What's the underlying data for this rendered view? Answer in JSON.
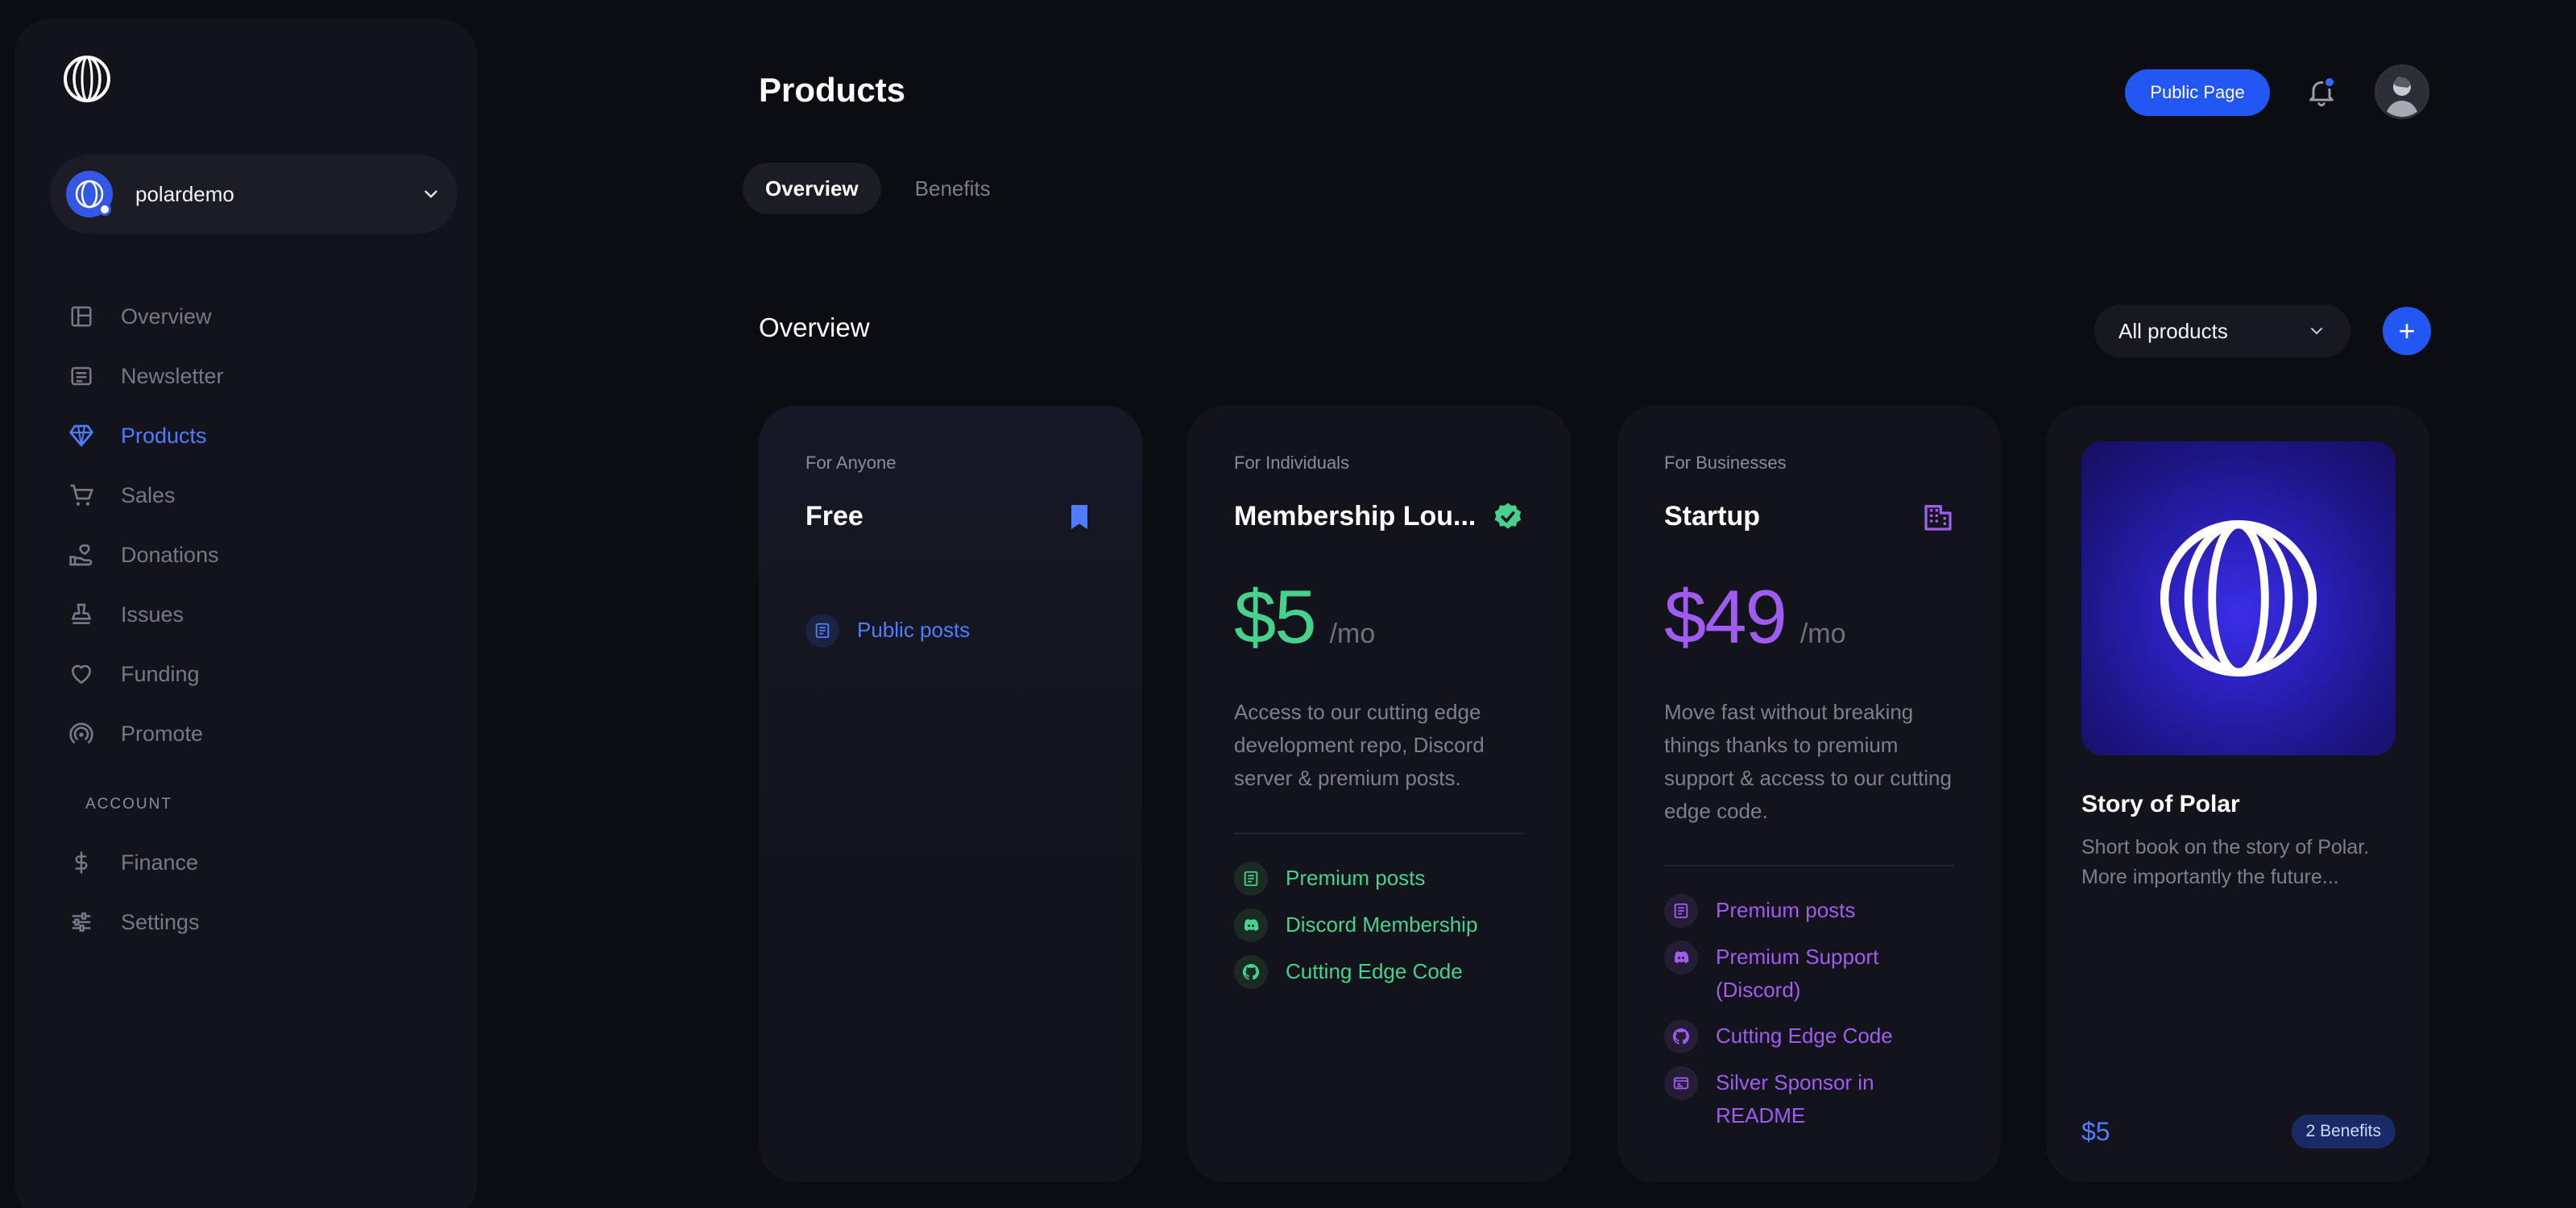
{
  "org": {
    "name": "polardemo"
  },
  "nav": {
    "items": [
      {
        "label": "Overview",
        "icon": "layout-icon",
        "active": false
      },
      {
        "label": "Newsletter",
        "icon": "newsletter-icon",
        "active": false
      },
      {
        "label": "Products",
        "icon": "diamond-icon",
        "active": true
      },
      {
        "label": "Sales",
        "icon": "cart-icon",
        "active": false
      },
      {
        "label": "Donations",
        "icon": "donation-icon",
        "active": false
      },
      {
        "label": "Issues",
        "icon": "stamp-icon",
        "active": false
      },
      {
        "label": "Funding",
        "icon": "heart-icon",
        "active": false
      },
      {
        "label": "Promote",
        "icon": "broadcast-icon",
        "active": false
      }
    ],
    "account_label": "ACCOUNT",
    "account_items": [
      {
        "label": "Finance",
        "icon": "dollar-icon"
      },
      {
        "label": "Settings",
        "icon": "sliders-icon"
      }
    ]
  },
  "header": {
    "title": "Products",
    "public_page_label": "Public Page"
  },
  "tabs": [
    {
      "label": "Overview",
      "active": true
    },
    {
      "label": "Benefits",
      "active": false
    }
  ],
  "section": {
    "title": "Overview",
    "filter_value": "All products",
    "add_label": "+"
  },
  "tiers": [
    {
      "label": "For Anyone",
      "name": "Free",
      "icon": "bookmark-icon",
      "accent": "#4f7cff",
      "benefits": [
        "Public posts"
      ]
    },
    {
      "label": "For Individuals",
      "name": "Membership Lou...",
      "icon": "verified-icon",
      "accent": "#46d28c",
      "price": "$5",
      "period": "/mo",
      "description": "Access to our cutting edge development repo, Discord server & premium posts.",
      "benefits": [
        "Premium posts",
        "Discord Membership",
        "Cutting Edge Code"
      ]
    },
    {
      "label": "For Businesses",
      "name": "Startup",
      "icon": "building-icon",
      "accent": "#a05cf2",
      "price": "$49",
      "period": "/mo",
      "description": "Move fast without breaking things thanks to premium support & access to our cutting edge code.",
      "benefits": [
        "Premium posts",
        "Premium Support (Discord)",
        "Cutting Edge Code",
        "Silver Sponsor in README"
      ]
    }
  ],
  "product": {
    "title": "Story of Polar",
    "description": "Short book on the story of Polar. More importantly the future...",
    "price": "$5",
    "badge": "2 Benefits"
  }
}
